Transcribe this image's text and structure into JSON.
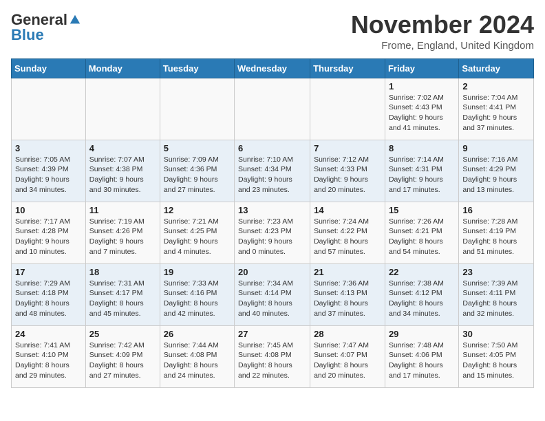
{
  "logo": {
    "general": "General",
    "blue": "Blue"
  },
  "title": "November 2024",
  "location": "Frome, England, United Kingdom",
  "weekdays": [
    "Sunday",
    "Monday",
    "Tuesday",
    "Wednesday",
    "Thursday",
    "Friday",
    "Saturday"
  ],
  "weeks": [
    [
      {
        "day": "",
        "info": ""
      },
      {
        "day": "",
        "info": ""
      },
      {
        "day": "",
        "info": ""
      },
      {
        "day": "",
        "info": ""
      },
      {
        "day": "",
        "info": ""
      },
      {
        "day": "1",
        "info": "Sunrise: 7:02 AM\nSunset: 4:43 PM\nDaylight: 9 hours\nand 41 minutes."
      },
      {
        "day": "2",
        "info": "Sunrise: 7:04 AM\nSunset: 4:41 PM\nDaylight: 9 hours\nand 37 minutes."
      }
    ],
    [
      {
        "day": "3",
        "info": "Sunrise: 7:05 AM\nSunset: 4:39 PM\nDaylight: 9 hours\nand 34 minutes."
      },
      {
        "day": "4",
        "info": "Sunrise: 7:07 AM\nSunset: 4:38 PM\nDaylight: 9 hours\nand 30 minutes."
      },
      {
        "day": "5",
        "info": "Sunrise: 7:09 AM\nSunset: 4:36 PM\nDaylight: 9 hours\nand 27 minutes."
      },
      {
        "day": "6",
        "info": "Sunrise: 7:10 AM\nSunset: 4:34 PM\nDaylight: 9 hours\nand 23 minutes."
      },
      {
        "day": "7",
        "info": "Sunrise: 7:12 AM\nSunset: 4:33 PM\nDaylight: 9 hours\nand 20 minutes."
      },
      {
        "day": "8",
        "info": "Sunrise: 7:14 AM\nSunset: 4:31 PM\nDaylight: 9 hours\nand 17 minutes."
      },
      {
        "day": "9",
        "info": "Sunrise: 7:16 AM\nSunset: 4:29 PM\nDaylight: 9 hours\nand 13 minutes."
      }
    ],
    [
      {
        "day": "10",
        "info": "Sunrise: 7:17 AM\nSunset: 4:28 PM\nDaylight: 9 hours\nand 10 minutes."
      },
      {
        "day": "11",
        "info": "Sunrise: 7:19 AM\nSunset: 4:26 PM\nDaylight: 9 hours\nand 7 minutes."
      },
      {
        "day": "12",
        "info": "Sunrise: 7:21 AM\nSunset: 4:25 PM\nDaylight: 9 hours\nand 4 minutes."
      },
      {
        "day": "13",
        "info": "Sunrise: 7:23 AM\nSunset: 4:23 PM\nDaylight: 9 hours\nand 0 minutes."
      },
      {
        "day": "14",
        "info": "Sunrise: 7:24 AM\nSunset: 4:22 PM\nDaylight: 8 hours\nand 57 minutes."
      },
      {
        "day": "15",
        "info": "Sunrise: 7:26 AM\nSunset: 4:21 PM\nDaylight: 8 hours\nand 54 minutes."
      },
      {
        "day": "16",
        "info": "Sunrise: 7:28 AM\nSunset: 4:19 PM\nDaylight: 8 hours\nand 51 minutes."
      }
    ],
    [
      {
        "day": "17",
        "info": "Sunrise: 7:29 AM\nSunset: 4:18 PM\nDaylight: 8 hours\nand 48 minutes."
      },
      {
        "day": "18",
        "info": "Sunrise: 7:31 AM\nSunset: 4:17 PM\nDaylight: 8 hours\nand 45 minutes."
      },
      {
        "day": "19",
        "info": "Sunrise: 7:33 AM\nSunset: 4:16 PM\nDaylight: 8 hours\nand 42 minutes."
      },
      {
        "day": "20",
        "info": "Sunrise: 7:34 AM\nSunset: 4:14 PM\nDaylight: 8 hours\nand 40 minutes."
      },
      {
        "day": "21",
        "info": "Sunrise: 7:36 AM\nSunset: 4:13 PM\nDaylight: 8 hours\nand 37 minutes."
      },
      {
        "day": "22",
        "info": "Sunrise: 7:38 AM\nSunset: 4:12 PM\nDaylight: 8 hours\nand 34 minutes."
      },
      {
        "day": "23",
        "info": "Sunrise: 7:39 AM\nSunset: 4:11 PM\nDaylight: 8 hours\nand 32 minutes."
      }
    ],
    [
      {
        "day": "24",
        "info": "Sunrise: 7:41 AM\nSunset: 4:10 PM\nDaylight: 8 hours\nand 29 minutes."
      },
      {
        "day": "25",
        "info": "Sunrise: 7:42 AM\nSunset: 4:09 PM\nDaylight: 8 hours\nand 27 minutes."
      },
      {
        "day": "26",
        "info": "Sunrise: 7:44 AM\nSunset: 4:08 PM\nDaylight: 8 hours\nand 24 minutes."
      },
      {
        "day": "27",
        "info": "Sunrise: 7:45 AM\nSunset: 4:08 PM\nDaylight: 8 hours\nand 22 minutes."
      },
      {
        "day": "28",
        "info": "Sunrise: 7:47 AM\nSunset: 4:07 PM\nDaylight: 8 hours\nand 20 minutes."
      },
      {
        "day": "29",
        "info": "Sunrise: 7:48 AM\nSunset: 4:06 PM\nDaylight: 8 hours\nand 17 minutes."
      },
      {
        "day": "30",
        "info": "Sunrise: 7:50 AM\nSunset: 4:05 PM\nDaylight: 8 hours\nand 15 minutes."
      }
    ]
  ]
}
